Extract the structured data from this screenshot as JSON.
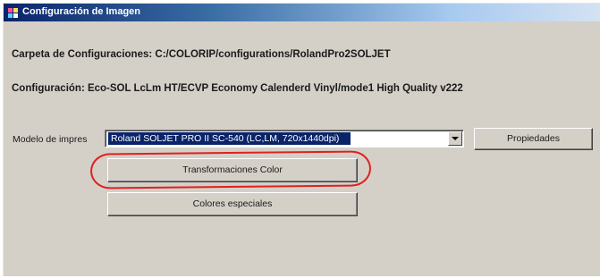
{
  "window": {
    "title": "Configuración de Imagen",
    "icon": "app-icon"
  },
  "info": {
    "folder": "Carpeta de Configuraciones: C:/COLORIP/configurations/RolandPro2SOLJET",
    "configuration": "Configuración: Eco-SOL LcLm HT/ECVP Economy Calenderd Vinyl/mode1 High Quality v222"
  },
  "printer": {
    "label": "Modelo de impres",
    "selected": "Roland SOLJET PRO II SC-540 (LC,LM, 720x1440dpi)",
    "properties_button": "Propiedades"
  },
  "buttons": {
    "color_transform": "Transformaciones Color",
    "special_colors": "Colores especiales"
  },
  "annotation": {
    "highlight_color": "#e02020"
  }
}
